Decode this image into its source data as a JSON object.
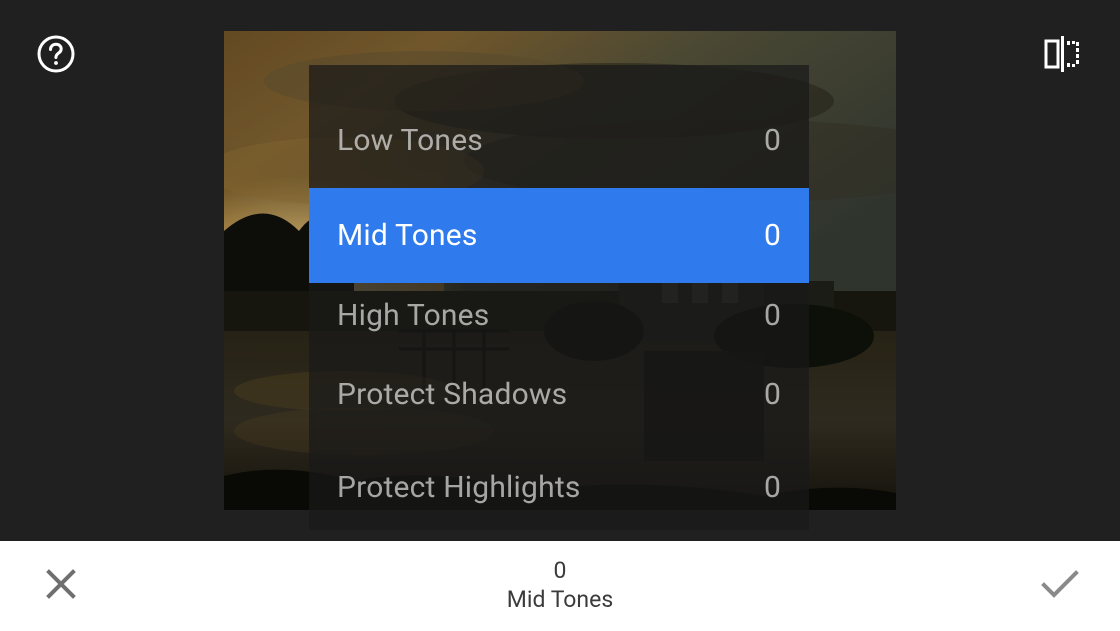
{
  "colors": {
    "accent": "#2f7bed",
    "background": "#202020",
    "bottom_bar": "#ffffff"
  },
  "icons": {
    "help": "help-circle-icon",
    "compare": "flip-compare-icon",
    "cancel": "close-icon",
    "confirm": "checkmark-icon"
  },
  "menu": {
    "items": [
      {
        "label": "Low Tones",
        "value": "0",
        "selected": false
      },
      {
        "label": "Mid Tones",
        "value": "0",
        "selected": true
      },
      {
        "label": "High Tones",
        "value": "0",
        "selected": false
      },
      {
        "label": "Protect Shadows",
        "value": "0",
        "selected": false
      },
      {
        "label": "Protect Highlights",
        "value": "0",
        "selected": false
      }
    ]
  },
  "status": {
    "value": "0",
    "label": "Mid Tones"
  }
}
